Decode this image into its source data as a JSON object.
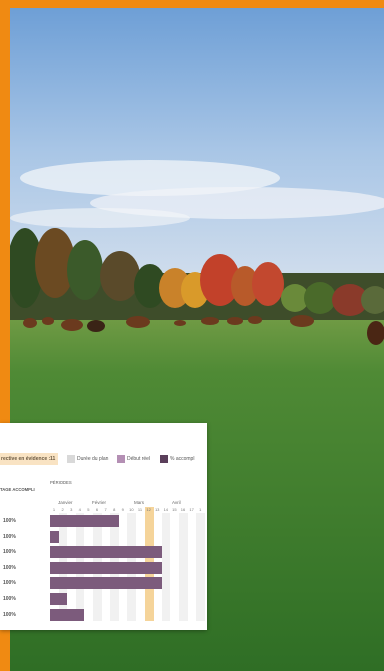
{
  "colors": {
    "accent_border": "#f08a12",
    "bar_actual": "#7c5b7c",
    "highlight_period": "#f5d49a",
    "plan_swatch": "#d9d9d9",
    "start_swatch": "#b48fb4",
    "sky_top": "#7ba9d9",
    "grass": "#3c7a2b"
  },
  "gantt": {
    "legend": {
      "highlight_label": "rective en évidence :",
      "highlight_value": "11",
      "plan_label": "Durée du plan",
      "start_label": "Début réel",
      "accomplished_label": "% accompl"
    },
    "columns": {
      "percent_header": "TAGE ACCOMPLI",
      "periods_header": "PÉRIODES"
    },
    "months": [
      "Janvier",
      "Février",
      "Mars",
      "Avril"
    ],
    "periods": [
      "1",
      "2",
      "3",
      "4",
      "5",
      "6",
      "7",
      "8",
      "9",
      "10",
      "11",
      "12",
      "13",
      "14",
      "15",
      "16",
      "17",
      "1"
    ],
    "highlight_period": 12,
    "rows": [
      {
        "percent": "100%",
        "start": 1,
        "duration": 8
      },
      {
        "percent": "100%",
        "start": 1,
        "duration": 1
      },
      {
        "percent": "100%",
        "start": 1,
        "duration": 13
      },
      {
        "percent": "100%",
        "start": 1,
        "duration": 13
      },
      {
        "percent": "100%",
        "start": 1,
        "duration": 13
      },
      {
        "percent": "100%",
        "start": 1,
        "duration": 2
      },
      {
        "percent": "100%",
        "start": 1,
        "duration": 4
      }
    ]
  }
}
